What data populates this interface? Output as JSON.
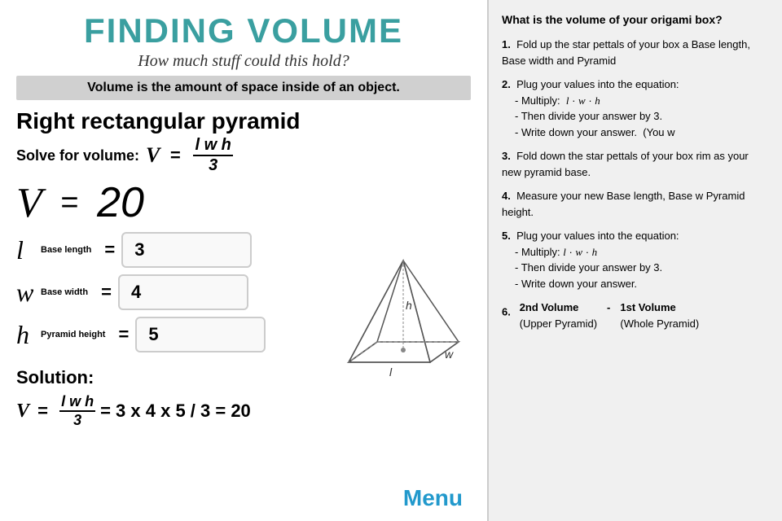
{
  "left": {
    "title": "FINDING VOLUME",
    "subtitle": "How much stuff could this hold?",
    "volume_statement": "Volume is the amount of space inside of an object.",
    "section_title": "Right rectangular pyramid",
    "solve_label": "Solve for volume:",
    "result_label": "V",
    "result_equals": "=",
    "result_value": "20",
    "vars": [
      {
        "symbol": "l",
        "subscript": "Base length",
        "value": "3"
      },
      {
        "symbol": "w",
        "subscript": "Base width",
        "value": "4"
      },
      {
        "symbol": "h",
        "subscript": "Pyramid height",
        "value": "5"
      }
    ],
    "solution_label": "Solution:",
    "solution_text": "V =",
    "solution_formula": "l w h",
    "solution_fraction_den": "3",
    "solution_expanded": "= 3 x 4 x 5 / 3 = 20",
    "menu_label": "Menu"
  },
  "right": {
    "question": "What is the volume of your origami box?",
    "steps": [
      {
        "num": "1.",
        "text": "Fold up the star pettals of your box a Base length, Base width and Pyramid"
      },
      {
        "num": "2.",
        "intro": "Plug your values into the equation:",
        "bullets": [
          "- Multiply:   l · w · h",
          "- Then divide your answer by 3.",
          "- Write down your answer.   (You w"
        ]
      },
      {
        "num": "3.",
        "text": "Fold down the star pettals of your bo rim as your new pyramid base."
      },
      {
        "num": "4.",
        "text": "Measure your new Base length, Base w Pyramid height."
      },
      {
        "num": "5.",
        "intro": "Plug your values into the equation:",
        "bullets": [
          "- Multiply:  l · w · h",
          "- Then divide your answer by 3.",
          "- Write down your answer."
        ]
      },
      {
        "num": "6.",
        "col1": "2nd Volume",
        "dash": "-",
        "col2": "1st Volume",
        "col1sub": "(Upper Pyramid)",
        "col2sub": "(Whole Pyramid)"
      }
    ]
  }
}
